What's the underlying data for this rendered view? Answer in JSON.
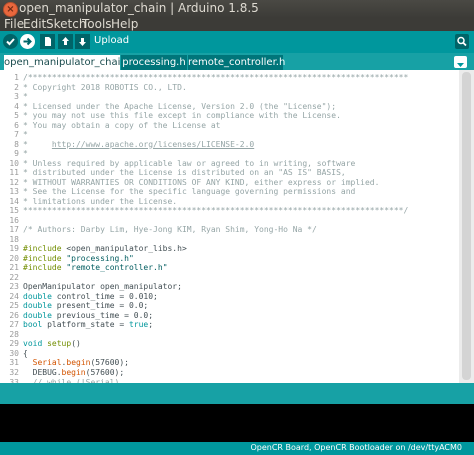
{
  "window": {
    "title": "open_manipulator_chain | Arduino 1.8.5",
    "close_symbol": "×"
  },
  "menu": [
    "File",
    "Edit",
    "Sketch",
    "Tools",
    "Help"
  ],
  "toolbar": {
    "hover_label": "Upload",
    "buttons": [
      "verify-icon",
      "upload-icon",
      "new-icon",
      "open-icon",
      "save-icon",
      "serial-monitor-icon"
    ]
  },
  "tabs": [
    "open_manipulator_chain",
    "processing.h",
    "remote_controller.h"
  ],
  "active_tab": 0,
  "editor": {
    "lines": [
      [
        [
          "cm",
          "/*******************************************************************************"
        ]
      ],
      [
        [
          "cm",
          "* Copyright 2018 ROBOTIS CO., LTD."
        ]
      ],
      [
        [
          "cm",
          "*"
        ]
      ],
      [
        [
          "cm",
          "* Licensed under the Apache License, Version 2.0 (the \"License\");"
        ]
      ],
      [
        [
          "cm",
          "* you may not use this file except in compliance with the License."
        ]
      ],
      [
        [
          "cm",
          "* You may obtain a copy of the License at"
        ]
      ],
      [
        [
          "cm",
          "*"
        ]
      ],
      [
        [
          "cm",
          "*     "
        ],
        [
          "lk",
          "http://www.apache.org/licenses/LICENSE-2.0"
        ]
      ],
      [
        [
          "cm",
          "*"
        ]
      ],
      [
        [
          "cm",
          "* Unless required by applicable law or agreed to in writing, software"
        ]
      ],
      [
        [
          "cm",
          "* distributed under the License is distributed on an \"AS IS\" BASIS,"
        ]
      ],
      [
        [
          "cm",
          "* WITHOUT WARRANTIES OR CONDITIONS OF ANY KIND, either express or implied."
        ]
      ],
      [
        [
          "cm",
          "* See the License for the specific language governing permissions and"
        ]
      ],
      [
        [
          "cm",
          "* limitations under the License."
        ]
      ],
      [
        [
          "cm",
          "*******************************************************************************/"
        ]
      ],
      [
        [
          "",
          ""
        ]
      ],
      [
        [
          "cm",
          "/* Authors: Darby Lim, Hye-Jong KIM, Ryan Shim, Yong-Ho Na */"
        ]
      ],
      [
        [
          "",
          ""
        ]
      ],
      [
        [
          "kw",
          "#include"
        ],
        [
          "",
          " <open_manipulator_libs.h>"
        ]
      ],
      [
        [
          "kw",
          "#include"
        ],
        [
          "",
          " "
        ],
        [
          "st",
          "\"processing.h\""
        ]
      ],
      [
        [
          "kw",
          "#include"
        ],
        [
          "",
          " "
        ],
        [
          "st",
          "\"remote_controller.h\""
        ]
      ],
      [
        [
          "",
          ""
        ]
      ],
      [
        [
          "",
          "OpenManipulator open_manipulator;"
        ]
      ],
      [
        [
          "ty",
          "double"
        ],
        [
          "",
          " control_time = 0.010;"
        ]
      ],
      [
        [
          "ty",
          "double"
        ],
        [
          "",
          " present_time = 0.0;"
        ]
      ],
      [
        [
          "ty",
          "double"
        ],
        [
          "",
          " previous_time = 0.0;"
        ]
      ],
      [
        [
          "ty",
          "bool"
        ],
        [
          "",
          " platform_state = "
        ],
        [
          "ty",
          "true"
        ],
        [
          "",
          ";"
        ]
      ],
      [
        [
          "",
          ""
        ]
      ],
      [
        [
          "ty",
          "void"
        ],
        [
          "",
          " "
        ],
        [
          "kw",
          "setup"
        ],
        [
          "",
          "()"
        ]
      ],
      [
        [
          "",
          "{"
        ]
      ],
      [
        [
          "",
          "  "
        ],
        [
          "fn",
          "Serial"
        ],
        [
          "",
          "."
        ],
        [
          "fn",
          "begin"
        ],
        [
          "",
          "(57600);"
        ]
      ],
      [
        [
          "",
          "  DEBUG."
        ],
        [
          "fn",
          "begin"
        ],
        [
          "",
          "(57600);"
        ]
      ],
      [
        [
          "",
          "  "
        ],
        [
          "cm",
          "// while (!Serial)"
        ]
      ]
    ]
  },
  "status": {
    "board": "OpenCR Board, OpenCR Bootloader on /dev/ttyACM0"
  }
}
